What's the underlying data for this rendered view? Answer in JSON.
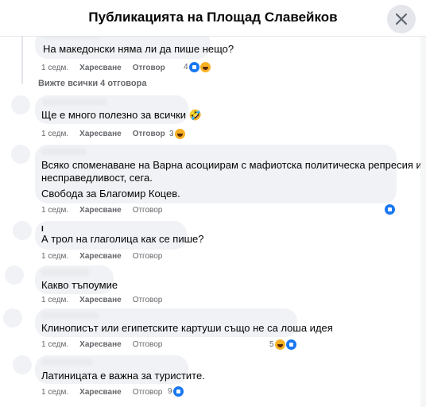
{
  "header": {
    "title": "Публикацията на Площад Славейков"
  },
  "actions": {
    "like": "Харесване",
    "reply": "Отговор"
  },
  "view_all_replies": "Вижте всички 4 отговора",
  "comments": [
    {
      "id": "c0",
      "text": "На македонски няма ли да пише нещо?",
      "time": "1 седм.",
      "reaction_count": "4",
      "reactions": [
        "like-icon",
        "haha-icon"
      ]
    },
    {
      "id": "c1",
      "text": "Ще е много полезно за всички 🤣",
      "time": "1 седм.",
      "reaction_count": "3",
      "reactions": [
        "haha-icon"
      ]
    },
    {
      "id": "c2",
      "text_line1": "Всяко споменаване на Варна асоциирам с мафиотска политическа репресия и",
      "text_line2": "несправедливост, сега.",
      "text_line3": "Свобода за Благомир Коцев.",
      "time": "1 седм.",
      "reaction_count": "",
      "reactions": [
        "like-icon"
      ]
    },
    {
      "id": "c3",
      "name_initial": "I",
      "text": "А трол на глаголица как се пише?",
      "time": "1 седм."
    },
    {
      "id": "c4",
      "text": "Какво тъпоумие",
      "time": "1 седм."
    },
    {
      "id": "c5",
      "text": "Клинописът или египетските картуши също не са лоша идея",
      "time": "1 седм.",
      "reaction_count": "5",
      "reactions": [
        "haha-icon",
        "like-icon"
      ]
    },
    {
      "id": "c6",
      "text": "Латиницата е важна за туристите.",
      "time": "1 седм.",
      "reaction_count": "9",
      "reactions": [
        "like-icon"
      ]
    }
  ]
}
